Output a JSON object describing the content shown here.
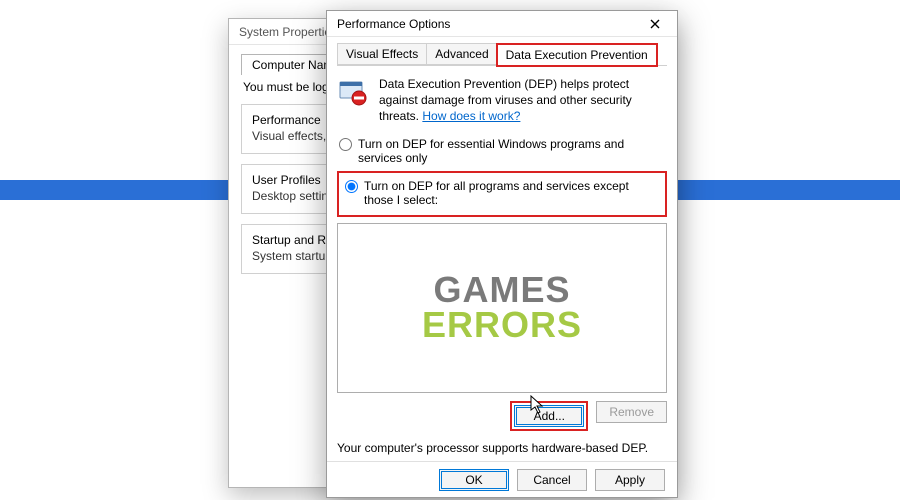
{
  "back_dialog": {
    "title": "System Properties",
    "tabs": [
      "Computer Name"
    ],
    "intro": "You must be log",
    "groups": [
      {
        "title": "Performance",
        "desc": "Visual effects,"
      },
      {
        "title": "User Profiles",
        "desc": "Desktop settin"
      },
      {
        "title": "Startup and Re",
        "desc": "System startup"
      }
    ]
  },
  "front_dialog": {
    "title": "Performance Options",
    "tabs": {
      "visual": "Visual Effects",
      "advanced": "Advanced",
      "dep": "Data Execution Prevention"
    },
    "desc": "Data Execution Prevention (DEP) helps protect against damage from viruses and other security threats. ",
    "link": "How does it work?",
    "radio1": "Turn on DEP for essential Windows programs and services only",
    "radio2": "Turn on DEP for all programs and services except those I select:",
    "add": "Add...",
    "remove": "Remove",
    "status": "Your computer's processor supports hardware-based DEP.",
    "ok": "OK",
    "cancel": "Cancel",
    "apply": "Apply"
  },
  "watermark": {
    "line1": "GAMES",
    "line2": "ERRORS"
  }
}
